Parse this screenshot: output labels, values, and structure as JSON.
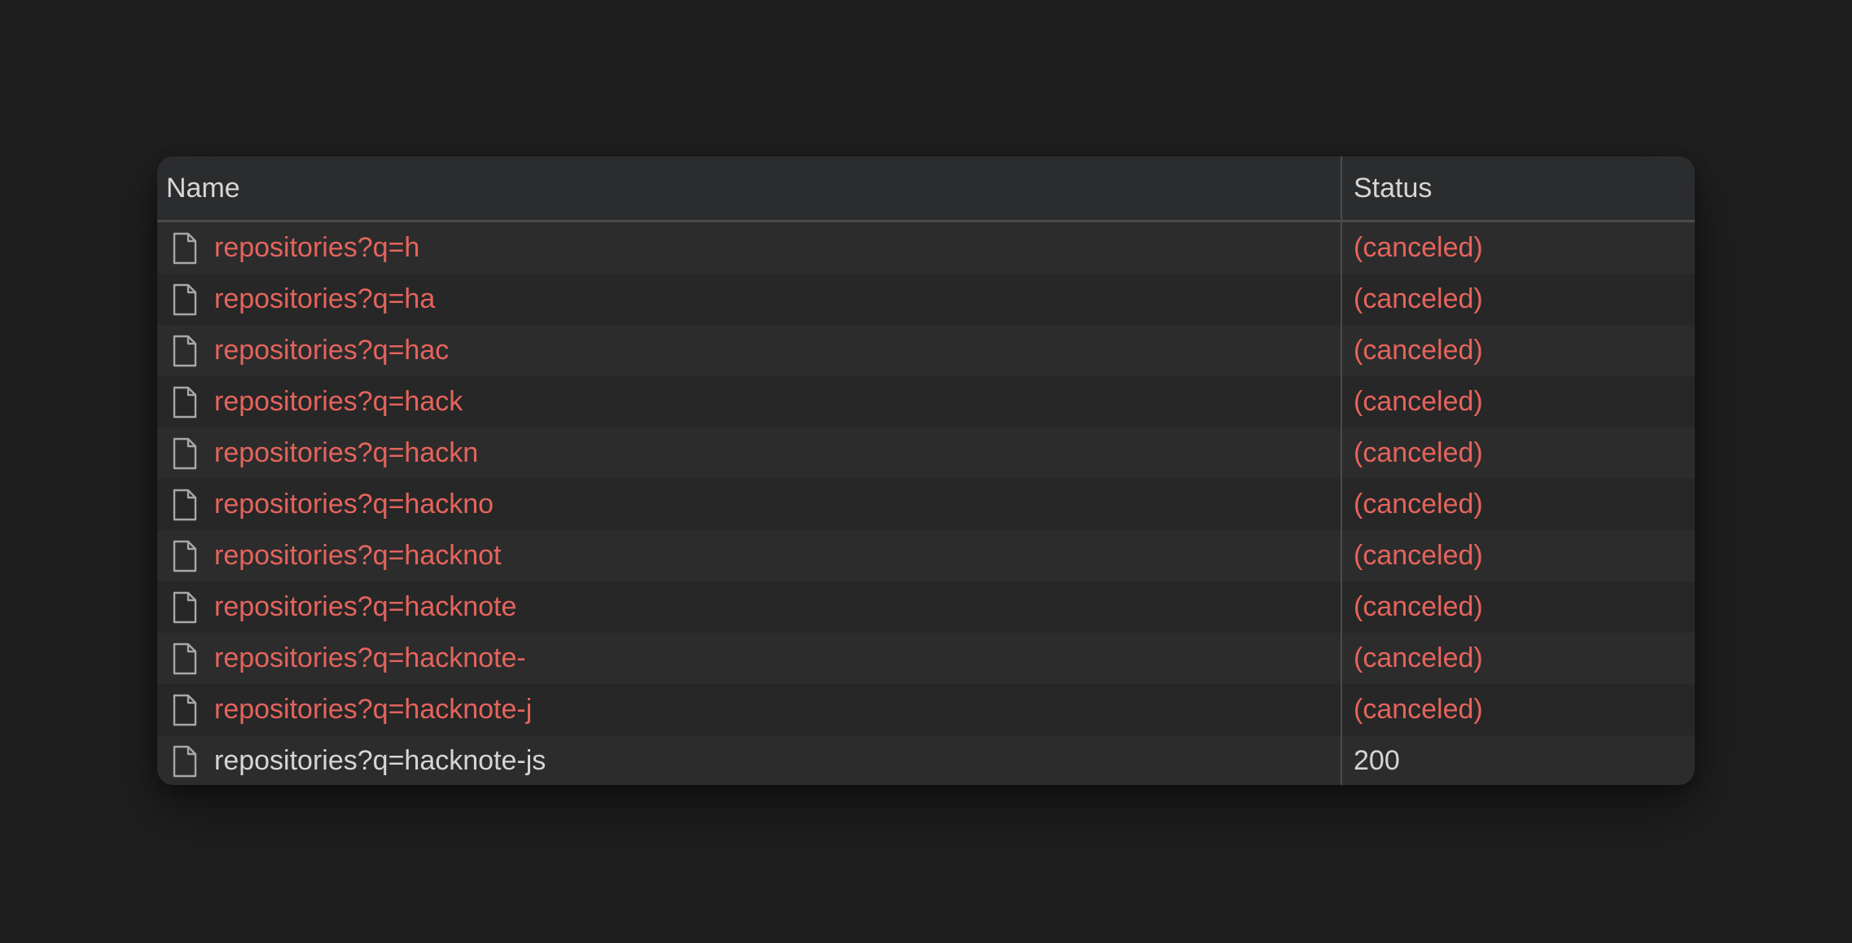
{
  "table": {
    "columns": {
      "name": "Name",
      "status": "Status"
    },
    "rows": [
      {
        "name": "repositories?q=h",
        "status": "(canceled)",
        "icon": "file-icon",
        "state": "error"
      },
      {
        "name": "repositories?q=ha",
        "status": "(canceled)",
        "icon": "file-icon",
        "state": "error"
      },
      {
        "name": "repositories?q=hac",
        "status": "(canceled)",
        "icon": "file-icon",
        "state": "error"
      },
      {
        "name": "repositories?q=hack",
        "status": "(canceled)",
        "icon": "file-icon",
        "state": "error"
      },
      {
        "name": "repositories?q=hackn",
        "status": "(canceled)",
        "icon": "file-icon",
        "state": "error"
      },
      {
        "name": "repositories?q=hackno",
        "status": "(canceled)",
        "icon": "file-icon",
        "state": "error"
      },
      {
        "name": "repositories?q=hacknot",
        "status": "(canceled)",
        "icon": "file-icon",
        "state": "error"
      },
      {
        "name": "repositories?q=hacknote",
        "status": "(canceled)",
        "icon": "file-icon",
        "state": "error"
      },
      {
        "name": "repositories?q=hacknote-",
        "status": "(canceled)",
        "icon": "file-icon",
        "state": "error"
      },
      {
        "name": "repositories?q=hacknote-j",
        "status": "(canceled)",
        "icon": "file-icon",
        "state": "error"
      },
      {
        "name": "repositories?q=hacknote-js",
        "status": "200",
        "icon": "file-icon",
        "state": "ok"
      }
    ]
  },
  "colors": {
    "background": "#1f1f1f",
    "panel": "#282828",
    "error_text": "#e5645c",
    "normal_text": "#d6d6d6",
    "divider": "#4a4b4d"
  }
}
